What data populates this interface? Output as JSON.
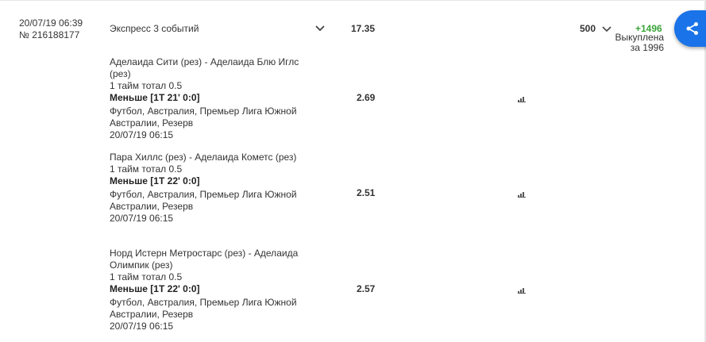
{
  "bet": {
    "date": "20/07/19 06:39",
    "number": "№ 216188177",
    "title": "Экспресс 3 событий",
    "total_odds": "17.35",
    "stake": "500",
    "win": "+1496",
    "cashout_line1": "Выкуплена",
    "cashout_line2": "за 1996",
    "icons": {
      "expand": "chevron-down-icon",
      "stake_dropdown": "chevron-down-icon",
      "share": "share-icon",
      "stats": "bar-chart-icon"
    },
    "colors": {
      "win": "#3aa53a",
      "share_button": "#1a73e8"
    }
  },
  "events": [
    {
      "teams": "Аделаида Сити (рез) - Аделаида Блю Иглс (рез)",
      "market": "1 тайм тотал 0.5",
      "pick": "Меньше [1T 21' 0:0]",
      "league": "Футбол, Австралия, Премьер Лига Южной Австралии, Резерв",
      "time": "20/07/19 06:15",
      "odds": "2.69"
    },
    {
      "teams": "Пара Хиллс (рез) - Аделаида Кометс (рез)",
      "market": "1 тайм тотал 0.5",
      "pick": "Меньше [1T 22' 0:0]",
      "league": "Футбол, Австралия, Премьер Лига Южной Австралии, Резерв",
      "time": "20/07/19 06:15",
      "odds": "2.51"
    },
    {
      "teams": "Норд Истерн Метростарс (рез) - Аделаида Олимпик (рез)",
      "market": "1 тайм тотал 0.5",
      "pick": "Меньше [1T 22' 0:0]",
      "league": "Футбол, Австралия, Премьер Лига Южной Австралии, Резерв",
      "time": "20/07/19 06:15",
      "odds": "2.57"
    }
  ]
}
